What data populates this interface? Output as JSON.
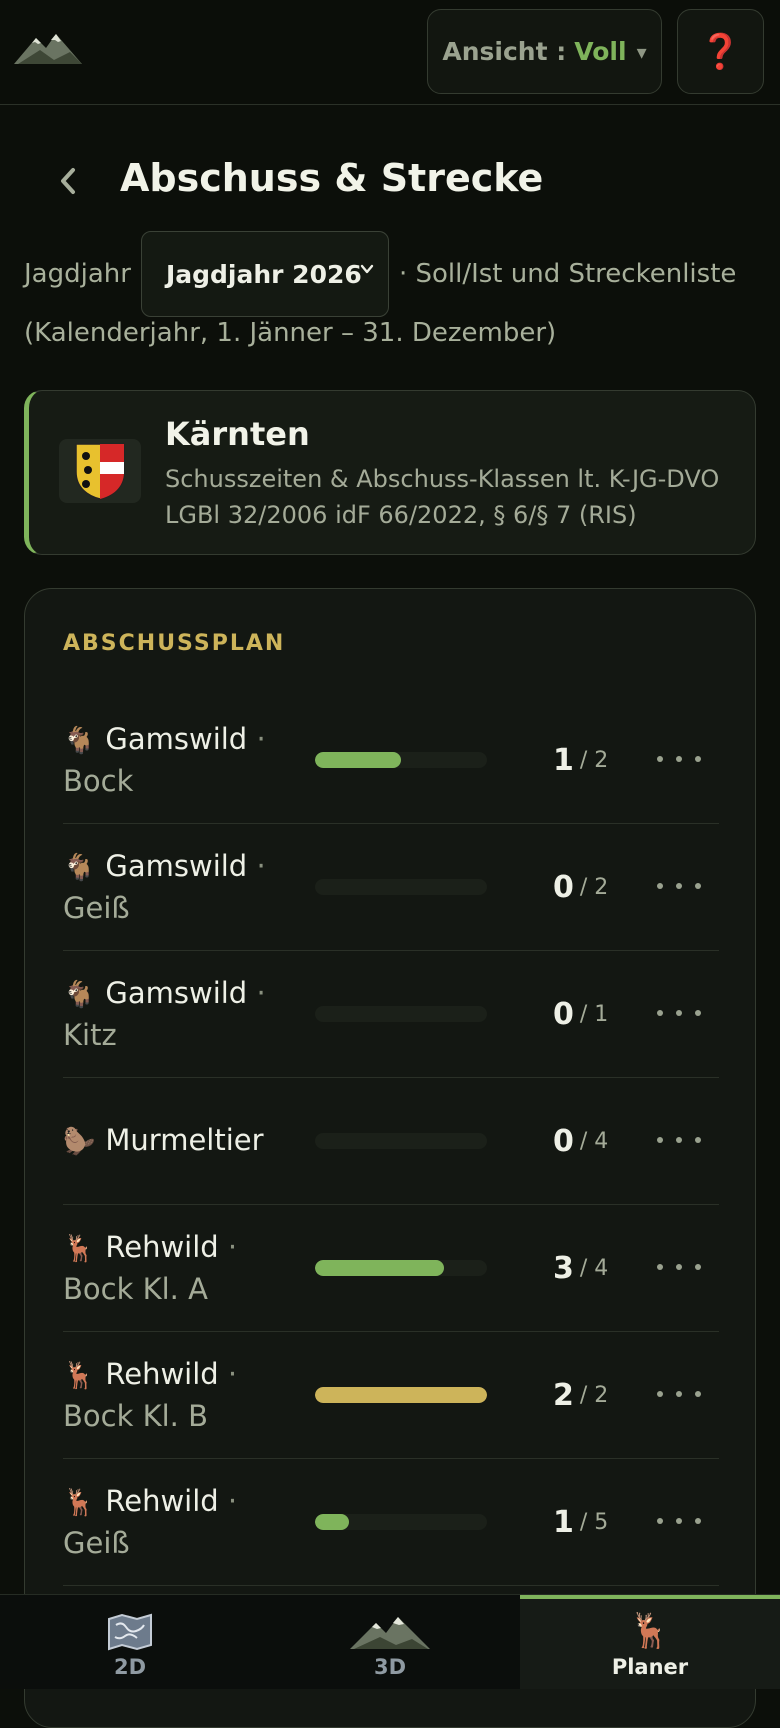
{
  "topbar": {
    "logo_icon": "mountain-logo-icon",
    "view_label": "Ansicht :",
    "view_value": "Voll",
    "view_caret": "▾",
    "help_label": "❓"
  },
  "header": {
    "title": "Abschuss & Strecke",
    "year_label": "Jagdjahr",
    "year_value": "Jagdjahr 2026",
    "year_suffix": "· Soll/Ist und Streckenliste",
    "calendar_note": "(Kalenderjahr, 1. Jänner – 31. Dezember)"
  },
  "region": {
    "name": "Kärnten",
    "description": "Schusszeiten & Abschuss-Klassen lt. K-JG-DVO LGBl 32/2006 idF 66/2022, § 6/§ 7 (RIS)",
    "crest_icon": "carinthia-crest-icon"
  },
  "plan": {
    "title": "ABSCHUSSPLAN",
    "rows": [
      {
        "emoji": "🐐",
        "species": "Gamswild",
        "sep": "·",
        "cls": "Bock",
        "ist": "1",
        "soll": "/ 2",
        "progress": 0.5
      },
      {
        "emoji": "🐐",
        "species": "Gamswild",
        "sep": "·",
        "cls": "Geiß",
        "ist": "0",
        "soll": "/ 2",
        "progress": 0
      },
      {
        "emoji": "🐐",
        "species": "Gamswild",
        "sep": "·",
        "cls": "Kitz",
        "ist": "0",
        "soll": "/ 1",
        "progress": 0
      },
      {
        "emoji": "🦫",
        "species": "Murmeltier",
        "sep": "",
        "cls": "",
        "ist": "0",
        "soll": "/ 4",
        "progress": 0
      },
      {
        "emoji": "🦌",
        "species": "Rehwild",
        "sep": "·",
        "cls": "Bock Kl. A",
        "ist": "3",
        "soll": "/ 4",
        "progress": 0.75
      },
      {
        "emoji": "🦌",
        "species": "Rehwild",
        "sep": "·",
        "cls": "Bock Kl. B",
        "ist": "2",
        "soll": "/ 2",
        "progress": 1
      },
      {
        "emoji": "🦌",
        "species": "Rehwild",
        "sep": "·",
        "cls": "Geiß",
        "ist": "1",
        "soll": "/ 5",
        "progress": 0.2
      }
    ]
  },
  "nav": {
    "tabs": [
      {
        "label": "2D",
        "icon": "map-icon"
      },
      {
        "label": "3D",
        "icon": "mountain-icon"
      },
      {
        "label": "Planer",
        "icon": "deer-icon",
        "active": true
      }
    ]
  },
  "colors": {
    "accent": "#7fb45b",
    "gold": "#cdb45a",
    "background": "#0c0f0a"
  }
}
